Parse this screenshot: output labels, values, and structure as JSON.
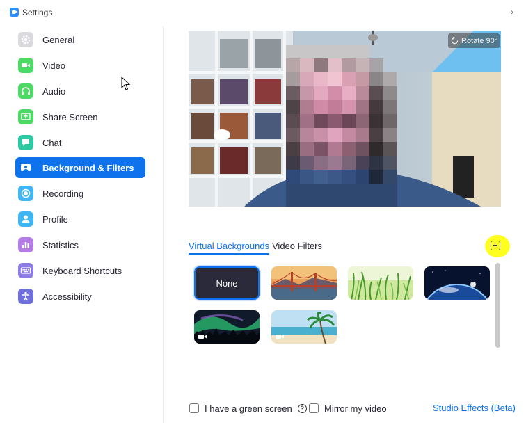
{
  "window": {
    "title": "Settings"
  },
  "sidebar": {
    "items": [
      {
        "label": "General",
        "icon": "gear-icon",
        "color": "#d9d9de",
        "active": false
      },
      {
        "label": "Video",
        "icon": "video-camera-icon",
        "color": "#4cd964",
        "active": false
      },
      {
        "label": "Audio",
        "icon": "headphones-icon",
        "color": "#4cd964",
        "active": false
      },
      {
        "label": "Share Screen",
        "icon": "share-screen-icon",
        "color": "#4cd964",
        "active": false
      },
      {
        "label": "Chat",
        "icon": "chat-bubble-icon",
        "color": "#2cc9a3",
        "active": false
      },
      {
        "label": "Background & Filters",
        "icon": "background-icon",
        "color": "#0e72ed",
        "active": true
      },
      {
        "label": "Recording",
        "icon": "record-icon",
        "color": "#3fb7f5",
        "active": false
      },
      {
        "label": "Profile",
        "icon": "person-icon",
        "color": "#3fb7f5",
        "active": false
      },
      {
        "label": "Statistics",
        "icon": "bar-chart-icon",
        "color": "#b57ce6",
        "active": false
      },
      {
        "label": "Keyboard Shortcuts",
        "icon": "keyboard-icon",
        "color": "#8d7ce6",
        "active": false
      },
      {
        "label": "Accessibility",
        "icon": "accessibility-icon",
        "color": "#6f6fdc",
        "active": false
      }
    ]
  },
  "preview": {
    "rotate_label": "Rotate 90°"
  },
  "tabs": [
    {
      "label": "Virtual Backgrounds",
      "active": true
    },
    {
      "label": "Video Filters",
      "active": false
    }
  ],
  "backgrounds": [
    {
      "label": "None",
      "kind": "none",
      "selected": true
    },
    {
      "kind": "golden-gate",
      "selected": false
    },
    {
      "kind": "grass",
      "selected": false
    },
    {
      "kind": "earth-space",
      "selected": false
    },
    {
      "kind": "aurora",
      "selected": false,
      "video": true
    },
    {
      "kind": "beach",
      "selected": false,
      "video": true
    }
  ],
  "footer": {
    "green_screen_label": "I have a green screen",
    "green_screen_checked": false,
    "mirror_label": "Mirror my video",
    "mirror_checked": false,
    "studio_effects_label": "Studio Effects (Beta)"
  },
  "colors": {
    "accent": "#0e72ed",
    "highlight": "#ffff1f"
  }
}
